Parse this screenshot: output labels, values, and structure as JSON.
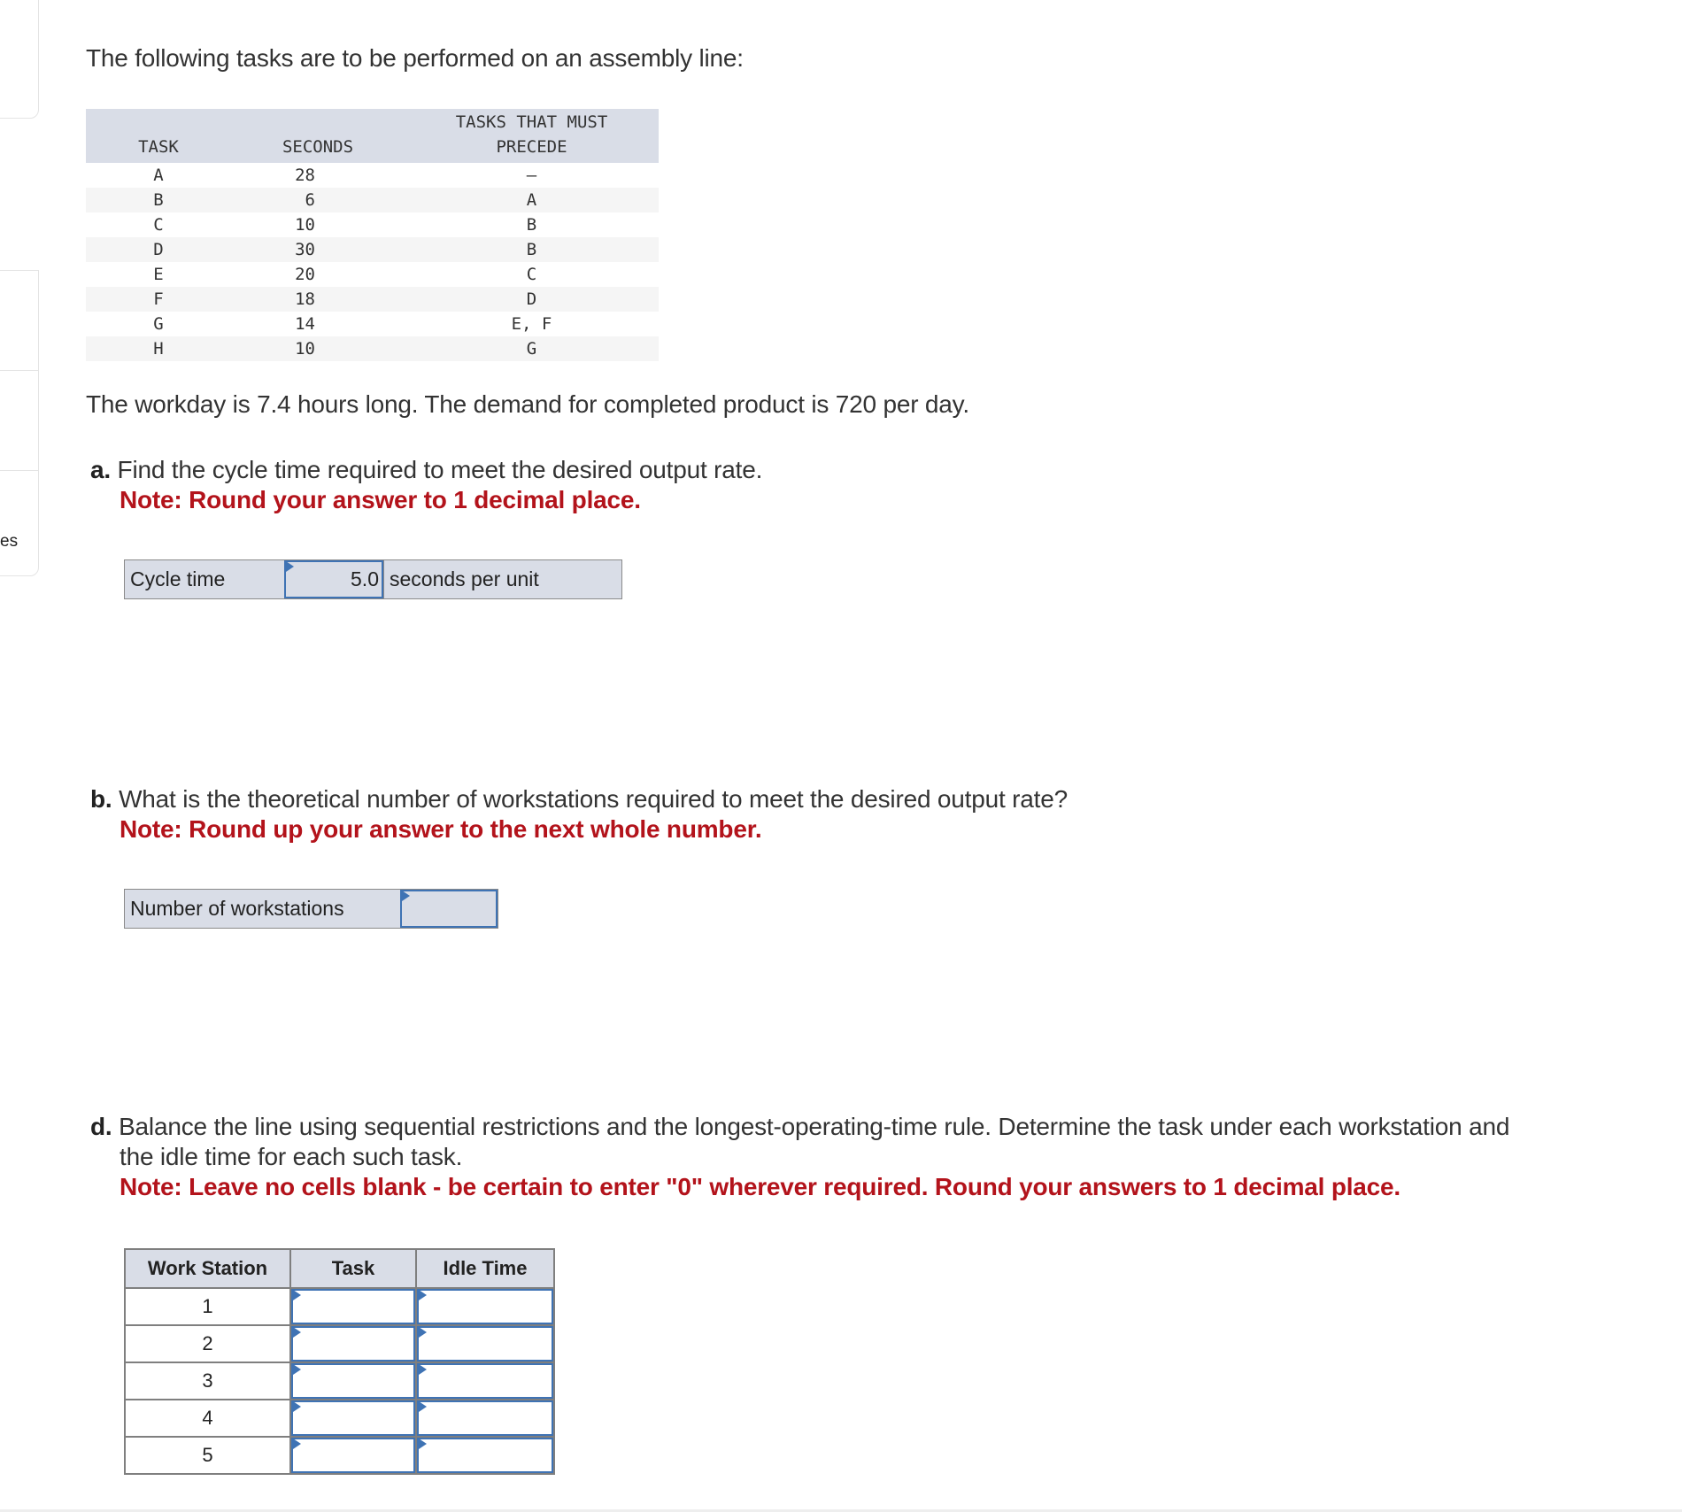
{
  "sidebar": {
    "partial_label": "es"
  },
  "intro": "The following tasks are to be performed on an assembly line:",
  "task_table": {
    "headers": {
      "task": "TASK",
      "seconds": "SECONDS",
      "precede_line1": "TASKS THAT MUST",
      "precede_line2": "PRECEDE"
    },
    "rows": [
      {
        "task": "A",
        "seconds": "28",
        "precede": "—"
      },
      {
        "task": "B",
        "seconds": "6",
        "precede": "A"
      },
      {
        "task": "C",
        "seconds": "10",
        "precede": "B"
      },
      {
        "task": "D",
        "seconds": "30",
        "precede": "B"
      },
      {
        "task": "E",
        "seconds": "20",
        "precede": "C"
      },
      {
        "task": "F",
        "seconds": "18",
        "precede": "D"
      },
      {
        "task": "G",
        "seconds": "14",
        "precede": "E, F"
      },
      {
        "task": "H",
        "seconds": "10",
        "precede": "G"
      }
    ]
  },
  "workday_text": "The workday is 7.4 hours long. The demand for completed product is 720 per day.",
  "part_a": {
    "letter": "a.",
    "question": "Find the cycle time required to meet the desired output rate.",
    "note": "Note: Round your answer to 1 decimal place.",
    "label": "Cycle time",
    "value": "5.0",
    "unit": "seconds per unit"
  },
  "part_b": {
    "letter": "b.",
    "question": "What is the theoretical number of workstations required to meet the desired output rate?",
    "note": "Note: Round up your answer to the next whole number.",
    "label": "Number of workstations",
    "value": ""
  },
  "part_d": {
    "letter": "d.",
    "question_line1": "Balance the line using sequential restrictions and the longest-operating-time rule. Determine the task under each workstation and",
    "question_line2": "the idle time for each such task.",
    "note": "Note: Leave no cells blank - be certain to enter \"0\" wherever required. Round your answers to 1 decimal place.",
    "headers": {
      "station": "Work Station",
      "task": "Task",
      "idle": "Idle Time"
    },
    "rows": [
      {
        "station": "1",
        "task": "",
        "idle": ""
      },
      {
        "station": "2",
        "task": "",
        "idle": ""
      },
      {
        "station": "3",
        "task": "",
        "idle": ""
      },
      {
        "station": "4",
        "task": "",
        "idle": ""
      },
      {
        "station": "5",
        "task": "",
        "idle": ""
      }
    ]
  }
}
